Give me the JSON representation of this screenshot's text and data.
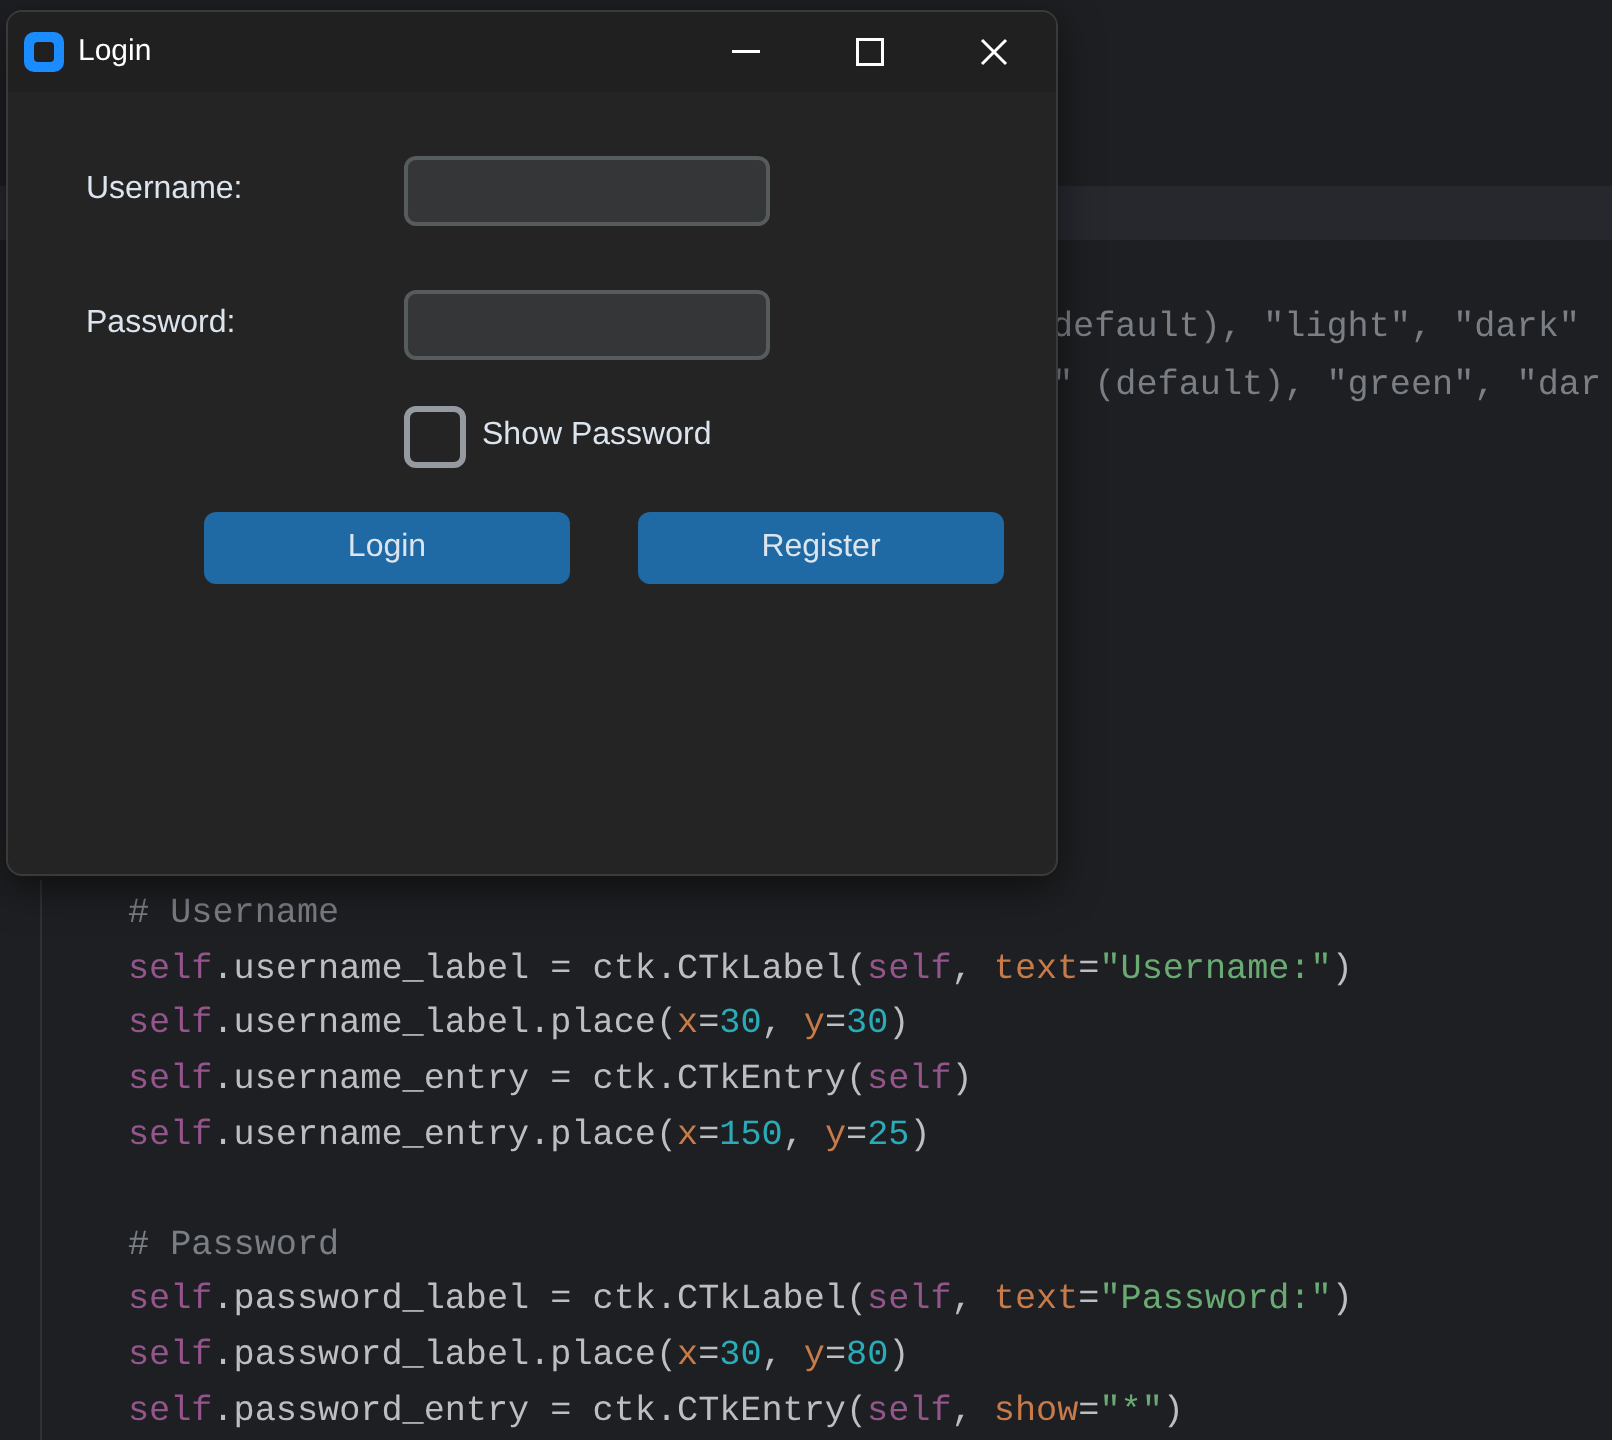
{
  "editor": {
    "lines": [
      {
        "kind": "highlight"
      },
      {
        "kind": "partial",
        "tokens": [
          {
            "kind": "comment",
            "text": "default), \"light\", \"dark\""
          }
        ]
      },
      {
        "kind": "partial",
        "tokens": [
          {
            "kind": "comment",
            "text": "\" (default), \"green\", \"dar"
          }
        ]
      },
      {
        "kind": "code",
        "tokens": [
          {
            "kind": "comment",
            "text": "# Username"
          }
        ]
      },
      {
        "kind": "code",
        "tokens": [
          {
            "kind": "self",
            "text": "self"
          },
          {
            "kind": "plain",
            "text": ".username_label = ctk.CTkLabel("
          },
          {
            "kind": "self",
            "text": "self"
          },
          {
            "kind": "plain",
            "text": ", "
          },
          {
            "kind": "param",
            "text": "text"
          },
          {
            "kind": "plain",
            "text": "="
          },
          {
            "kind": "string",
            "text": "\"Username:\""
          },
          {
            "kind": "plain",
            "text": ")"
          }
        ]
      },
      {
        "kind": "code",
        "tokens": [
          {
            "kind": "self",
            "text": "self"
          },
          {
            "kind": "plain",
            "text": ".username_label.place("
          },
          {
            "kind": "param",
            "text": "x"
          },
          {
            "kind": "plain",
            "text": "="
          },
          {
            "kind": "number",
            "text": "30"
          },
          {
            "kind": "plain",
            "text": ", "
          },
          {
            "kind": "param",
            "text": "y"
          },
          {
            "kind": "plain",
            "text": "="
          },
          {
            "kind": "number",
            "text": "30"
          },
          {
            "kind": "plain",
            "text": ")"
          }
        ]
      },
      {
        "kind": "code",
        "tokens": [
          {
            "kind": "self",
            "text": "self"
          },
          {
            "kind": "plain",
            "text": ".username_entry = ctk.CTkEntry("
          },
          {
            "kind": "self",
            "text": "self"
          },
          {
            "kind": "plain",
            "text": ")"
          }
        ]
      },
      {
        "kind": "code",
        "tokens": [
          {
            "kind": "self",
            "text": "self"
          },
          {
            "kind": "plain",
            "text": ".username_entry.place("
          },
          {
            "kind": "param",
            "text": "x"
          },
          {
            "kind": "plain",
            "text": "="
          },
          {
            "kind": "number",
            "text": "150"
          },
          {
            "kind": "plain",
            "text": ", "
          },
          {
            "kind": "param",
            "text": "y"
          },
          {
            "kind": "plain",
            "text": "="
          },
          {
            "kind": "number",
            "text": "25"
          },
          {
            "kind": "plain",
            "text": ")"
          }
        ]
      },
      {
        "kind": "code"
      },
      {
        "kind": "code",
        "tokens": [
          {
            "kind": "comment",
            "text": "# Password"
          }
        ]
      },
      {
        "kind": "code",
        "tokens": [
          {
            "kind": "self",
            "text": "self"
          },
          {
            "kind": "plain",
            "text": ".password_label = ctk.CTkLabel("
          },
          {
            "kind": "self",
            "text": "self"
          },
          {
            "kind": "plain",
            "text": ", "
          },
          {
            "kind": "param",
            "text": "text"
          },
          {
            "kind": "plain",
            "text": "="
          },
          {
            "kind": "string",
            "text": "\"Password:\""
          },
          {
            "kind": "plain",
            "text": ")"
          }
        ]
      },
      {
        "kind": "code",
        "tokens": [
          {
            "kind": "self",
            "text": "self"
          },
          {
            "kind": "plain",
            "text": ".password_label.place("
          },
          {
            "kind": "param",
            "text": "x"
          },
          {
            "kind": "plain",
            "text": "="
          },
          {
            "kind": "number",
            "text": "30"
          },
          {
            "kind": "plain",
            "text": ", "
          },
          {
            "kind": "param",
            "text": "y"
          },
          {
            "kind": "plain",
            "text": "="
          },
          {
            "kind": "number",
            "text": "80"
          },
          {
            "kind": "plain",
            "text": ")"
          }
        ]
      },
      {
        "kind": "code",
        "tokens": [
          {
            "kind": "self",
            "text": "self"
          },
          {
            "kind": "plain",
            "text": ".password_entry = ctk.CTkEntry("
          },
          {
            "kind": "self",
            "text": "self"
          },
          {
            "kind": "plain",
            "text": ", "
          },
          {
            "kind": "param",
            "text": "show"
          },
          {
            "kind": "plain",
            "text": "="
          },
          {
            "kind": "string",
            "text": "\"*\""
          },
          {
            "kind": "plain",
            "text": ")"
          }
        ]
      }
    ]
  },
  "window": {
    "title": "Login",
    "fields": [
      {
        "label": "Username:"
      },
      {
        "label": "Password:"
      }
    ],
    "checkbox": {
      "label": "Show Password",
      "checked": false
    },
    "buttons": [
      "Login",
      "Register"
    ]
  }
}
